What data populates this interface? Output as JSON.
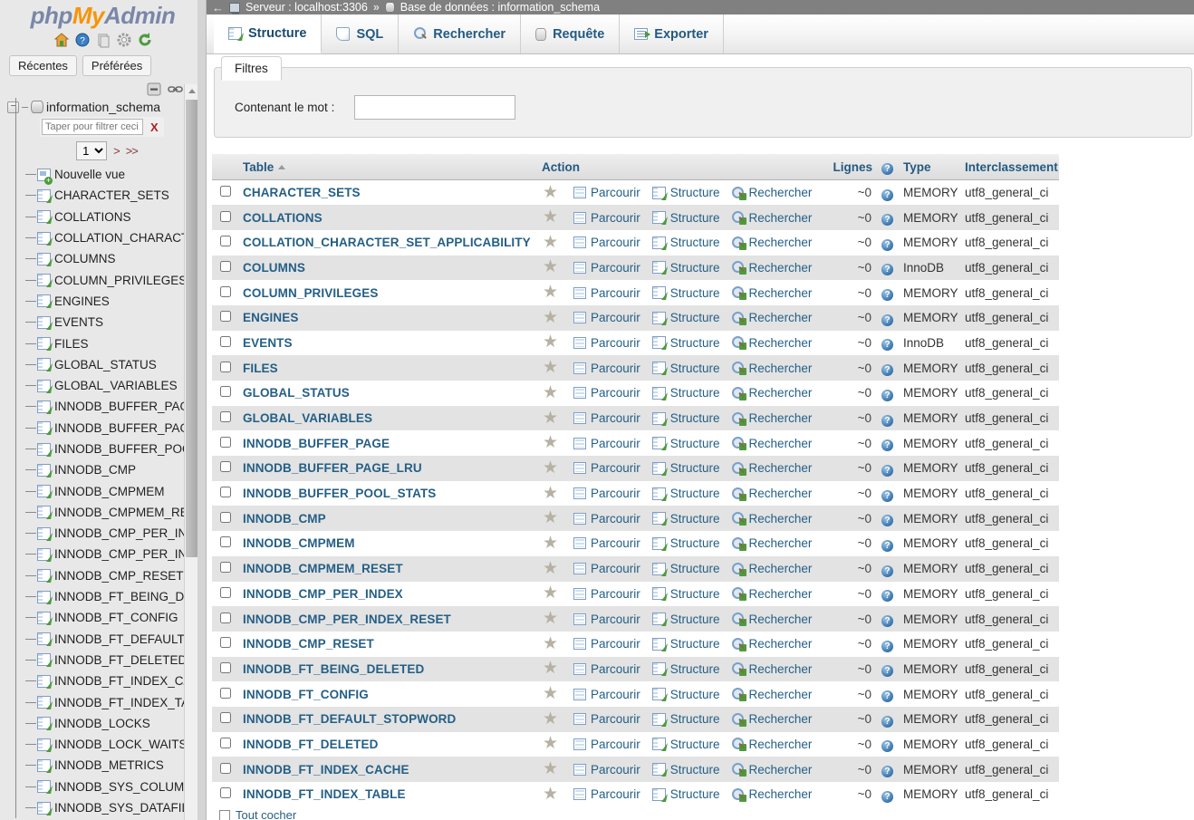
{
  "app": {
    "logo_php": "php",
    "logo_my": "My",
    "logo_admin": "Admin"
  },
  "sidebar": {
    "icons": [
      {
        "name": "home-icon",
        "label": "Accueil"
      },
      {
        "name": "help-icon",
        "label": "Aide"
      },
      {
        "name": "documentation-icon",
        "label": "Documentation"
      },
      {
        "name": "settings-icon",
        "label": "Paramètres"
      },
      {
        "name": "reload-icon",
        "label": "Recharger"
      }
    ],
    "quick_tabs": [
      {
        "label": "Récentes"
      },
      {
        "label": "Préférées"
      }
    ],
    "tree_controls": [
      {
        "name": "collapse-all-icon",
        "label": "Tout réduire"
      },
      {
        "name": "link-panels-icon",
        "label": "Lier avec le panneau principal"
      }
    ],
    "database": "information_schema",
    "filter_placeholder": "Taper pour filtrer ceci, En",
    "filter_value": "",
    "filter_clear": "X",
    "page_selected": "1",
    "page_options": [
      "1"
    ],
    "next_label": ">",
    "last_label": ">>",
    "items": [
      {
        "label": "Nouvelle vue",
        "icon": "new-view-icon"
      },
      {
        "label": "CHARACTER_SETS",
        "icon": "table-icon"
      },
      {
        "label": "COLLATIONS",
        "icon": "table-icon"
      },
      {
        "label": "COLLATION_CHARACTE",
        "icon": "table-icon"
      },
      {
        "label": "COLUMNS",
        "icon": "table-icon"
      },
      {
        "label": "COLUMN_PRIVILEGES",
        "icon": "table-icon"
      },
      {
        "label": "ENGINES",
        "icon": "table-icon"
      },
      {
        "label": "EVENTS",
        "icon": "table-icon"
      },
      {
        "label": "FILES",
        "icon": "table-icon"
      },
      {
        "label": "GLOBAL_STATUS",
        "icon": "table-icon"
      },
      {
        "label": "GLOBAL_VARIABLES",
        "icon": "table-icon"
      },
      {
        "label": "INNODB_BUFFER_PAGE",
        "icon": "table-icon"
      },
      {
        "label": "INNODB_BUFFER_PAGE_",
        "icon": "table-icon"
      },
      {
        "label": "INNODB_BUFFER_POOL",
        "icon": "table-icon"
      },
      {
        "label": "INNODB_CMP",
        "icon": "table-icon"
      },
      {
        "label": "INNODB_CMPMEM",
        "icon": "table-icon"
      },
      {
        "label": "INNODB_CMPMEM_RESE",
        "icon": "table-icon"
      },
      {
        "label": "INNODB_CMP_PER_INDE",
        "icon": "table-icon"
      },
      {
        "label": "INNODB_CMP_PER_INDE",
        "icon": "table-icon"
      },
      {
        "label": "INNODB_CMP_RESET",
        "icon": "table-icon"
      },
      {
        "label": "INNODB_FT_BEING_DEL",
        "icon": "table-icon"
      },
      {
        "label": "INNODB_FT_CONFIG",
        "icon": "table-icon"
      },
      {
        "label": "INNODB_FT_DEFAULT_S",
        "icon": "table-icon"
      },
      {
        "label": "INNODB_FT_DELETED",
        "icon": "table-icon"
      },
      {
        "label": "INNODB_FT_INDEX_CAC",
        "icon": "table-icon"
      },
      {
        "label": "INNODB_FT_INDEX_TAB",
        "icon": "table-icon"
      },
      {
        "label": "INNODB_LOCKS",
        "icon": "table-icon"
      },
      {
        "label": "INNODB_LOCK_WAITS",
        "icon": "table-icon"
      },
      {
        "label": "INNODB_METRICS",
        "icon": "table-icon"
      },
      {
        "label": "INNODB_SYS_COLUMNS",
        "icon": "table-icon"
      },
      {
        "label": "INNODB_SYS_DATAFILE",
        "icon": "table-icon"
      }
    ]
  },
  "breadcrumb": {
    "back": "←",
    "server_label": "Serveur : localhost:3306",
    "separator": "»",
    "db_label": "Base de données : information_schema"
  },
  "tabs": [
    {
      "label": "Structure",
      "icon": "structure-icon",
      "active": true
    },
    {
      "label": "SQL",
      "icon": "sql-icon",
      "active": false
    },
    {
      "label": "Rechercher",
      "icon": "search-icon",
      "active": false
    },
    {
      "label": "Requête",
      "icon": "query-icon",
      "active": false
    },
    {
      "label": "Exporter",
      "icon": "export-icon",
      "active": false
    }
  ],
  "filters": {
    "legend": "Filtres",
    "word_label": "Contenant le mot :",
    "word_value": "",
    "word_placeholder": ""
  },
  "table": {
    "columns": {
      "check": "",
      "name": "Table",
      "action": "Action",
      "rows": "Lignes",
      "rows_help": "?",
      "type": "Type",
      "collation": "Interclassement"
    },
    "actions": {
      "browse": "Parcourir",
      "structure": "Structure",
      "search": "Rechercher"
    },
    "bottom_check_all": "Tout cocher",
    "rows": [
      {
        "name": "CHARACTER_SETS",
        "rows": "~0",
        "type": "MEMORY",
        "collation": "utf8_general_ci"
      },
      {
        "name": "COLLATIONS",
        "rows": "~0",
        "type": "MEMORY",
        "collation": "utf8_general_ci"
      },
      {
        "name": "COLLATION_CHARACTER_SET_APPLICABILITY",
        "rows": "~0",
        "type": "MEMORY",
        "collation": "utf8_general_ci"
      },
      {
        "name": "COLUMNS",
        "rows": "~0",
        "type": "InnoDB",
        "collation": "utf8_general_ci"
      },
      {
        "name": "COLUMN_PRIVILEGES",
        "rows": "~0",
        "type": "MEMORY",
        "collation": "utf8_general_ci"
      },
      {
        "name": "ENGINES",
        "rows": "~0",
        "type": "MEMORY",
        "collation": "utf8_general_ci"
      },
      {
        "name": "EVENTS",
        "rows": "~0",
        "type": "InnoDB",
        "collation": "utf8_general_ci"
      },
      {
        "name": "FILES",
        "rows": "~0",
        "type": "MEMORY",
        "collation": "utf8_general_ci"
      },
      {
        "name": "GLOBAL_STATUS",
        "rows": "~0",
        "type": "MEMORY",
        "collation": "utf8_general_ci"
      },
      {
        "name": "GLOBAL_VARIABLES",
        "rows": "~0",
        "type": "MEMORY",
        "collation": "utf8_general_ci"
      },
      {
        "name": "INNODB_BUFFER_PAGE",
        "rows": "~0",
        "type": "MEMORY",
        "collation": "utf8_general_ci"
      },
      {
        "name": "INNODB_BUFFER_PAGE_LRU",
        "rows": "~0",
        "type": "MEMORY",
        "collation": "utf8_general_ci"
      },
      {
        "name": "INNODB_BUFFER_POOL_STATS",
        "rows": "~0",
        "type": "MEMORY",
        "collation": "utf8_general_ci"
      },
      {
        "name": "INNODB_CMP",
        "rows": "~0",
        "type": "MEMORY",
        "collation": "utf8_general_ci"
      },
      {
        "name": "INNODB_CMPMEM",
        "rows": "~0",
        "type": "MEMORY",
        "collation": "utf8_general_ci"
      },
      {
        "name": "INNODB_CMPMEM_RESET",
        "rows": "~0",
        "type": "MEMORY",
        "collation": "utf8_general_ci"
      },
      {
        "name": "INNODB_CMP_PER_INDEX",
        "rows": "~0",
        "type": "MEMORY",
        "collation": "utf8_general_ci"
      },
      {
        "name": "INNODB_CMP_PER_INDEX_RESET",
        "rows": "~0",
        "type": "MEMORY",
        "collation": "utf8_general_ci"
      },
      {
        "name": "INNODB_CMP_RESET",
        "rows": "~0",
        "type": "MEMORY",
        "collation": "utf8_general_ci"
      },
      {
        "name": "INNODB_FT_BEING_DELETED",
        "rows": "~0",
        "type": "MEMORY",
        "collation": "utf8_general_ci"
      },
      {
        "name": "INNODB_FT_CONFIG",
        "rows": "~0",
        "type": "MEMORY",
        "collation": "utf8_general_ci"
      },
      {
        "name": "INNODB_FT_DEFAULT_STOPWORD",
        "rows": "~0",
        "type": "MEMORY",
        "collation": "utf8_general_ci"
      },
      {
        "name": "INNODB_FT_DELETED",
        "rows": "~0",
        "type": "MEMORY",
        "collation": "utf8_general_ci"
      },
      {
        "name": "INNODB_FT_INDEX_CACHE",
        "rows": "~0",
        "type": "MEMORY",
        "collation": "utf8_general_ci"
      },
      {
        "name": "INNODB_FT_INDEX_TABLE",
        "rows": "~0",
        "type": "MEMORY",
        "collation": "utf8_general_ci"
      }
    ]
  }
}
